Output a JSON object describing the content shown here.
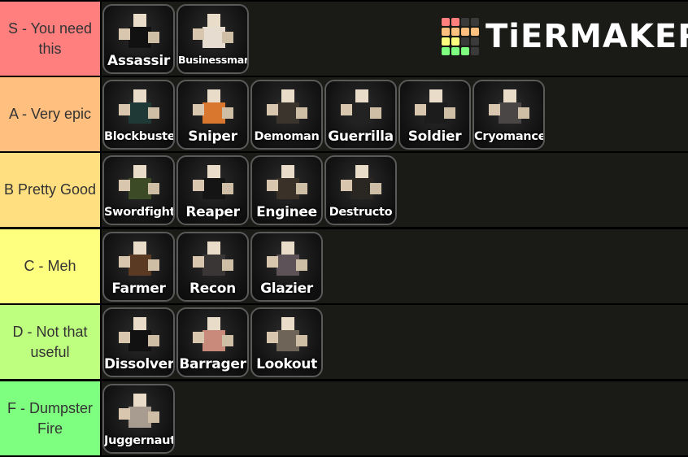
{
  "branding": {
    "logo_text": "TiERMAKER",
    "logo_grid_colors": [
      "#ff7f7f",
      "#ff7f7f",
      "#3a3a3a",
      "#3a3a3a",
      "#ffbf7f",
      "#ffbf7f",
      "#ffbf7f",
      "#ffbf7f",
      "#ffff7f",
      "#ffff7f",
      "#3a3a3a",
      "#3a3a3a",
      "#7fff7f",
      "#7fff7f",
      "#7fff7f",
      "#3a3a3a"
    ]
  },
  "tiers": [
    {
      "label": "S - You need this",
      "color": "#ff7f7f",
      "items": [
        {
          "name": "Assassin",
          "shown": "Assassir",
          "size": "big",
          "color": "#111111"
        },
        {
          "name": "Businessman",
          "shown": "Businessmar",
          "size": "small",
          "color": "#e6ddd0"
        }
      ]
    },
    {
      "label": "A - Very epic",
      "color": "#ffbf7f",
      "items": [
        {
          "name": "Blockbuster",
          "shown": "Blockbuste",
          "size": "mid",
          "color": "#1f3a36"
        },
        {
          "name": "Sniper",
          "shown": "Sniper",
          "size": "big",
          "color": "#d9772f"
        },
        {
          "name": "Demoman",
          "shown": "Demoman",
          "size": "mid",
          "color": "#3a342c"
        },
        {
          "name": "Guerrilla",
          "shown": "Guerrilla",
          "size": "big",
          "color": "#222222"
        },
        {
          "name": "Soldier",
          "shown": "Soldier",
          "size": "big",
          "color": "#1c1c1c"
        },
        {
          "name": "Cryomancer",
          "shown": "Cryomancer",
          "size": "mid",
          "color": "#4a4646"
        }
      ]
    },
    {
      "label": "B Pretty Good",
      "color": "#ffdf7f",
      "items": [
        {
          "name": "Swordfighter",
          "shown": "Swordfighte",
          "size": "mid",
          "color": "#3d4a26"
        },
        {
          "name": "Reaper",
          "shown": "Reaper",
          "size": "big",
          "color": "#141414"
        },
        {
          "name": "Engineer",
          "shown": "Enginee",
          "size": "big",
          "color": "#3a3128"
        },
        {
          "name": "Destructor",
          "shown": "Destructo",
          "size": "mid",
          "color": "#2a2622"
        }
      ]
    },
    {
      "label": "C - Meh",
      "color": "#ffff7f",
      "items": [
        {
          "name": "Farmer",
          "shown": "Farmer",
          "size": "big",
          "color": "#5a3a22"
        },
        {
          "name": "Recon",
          "shown": "Recon",
          "size": "big",
          "color": "#3a3636"
        },
        {
          "name": "Glazier",
          "shown": "Glazier",
          "size": "big",
          "color": "#5c5258"
        }
      ]
    },
    {
      "label": "D - Not that useful",
      "color": "#bfff7f",
      "items": [
        {
          "name": "Dissolver",
          "shown": "Dissolver",
          "size": "big",
          "color": "#111111"
        },
        {
          "name": "Barrager",
          "shown": "Barrager",
          "size": "big",
          "color": "#c98a7c"
        },
        {
          "name": "Lookout",
          "shown": "Lookout",
          "size": "big",
          "color": "#6e6458"
        }
      ]
    },
    {
      "label": "F - Dumpster Fire",
      "color": "#7fff7f",
      "items": [
        {
          "name": "Juggernaut",
          "shown": "Juggernaut",
          "size": "mid",
          "color": "#a89c90"
        }
      ]
    }
  ]
}
